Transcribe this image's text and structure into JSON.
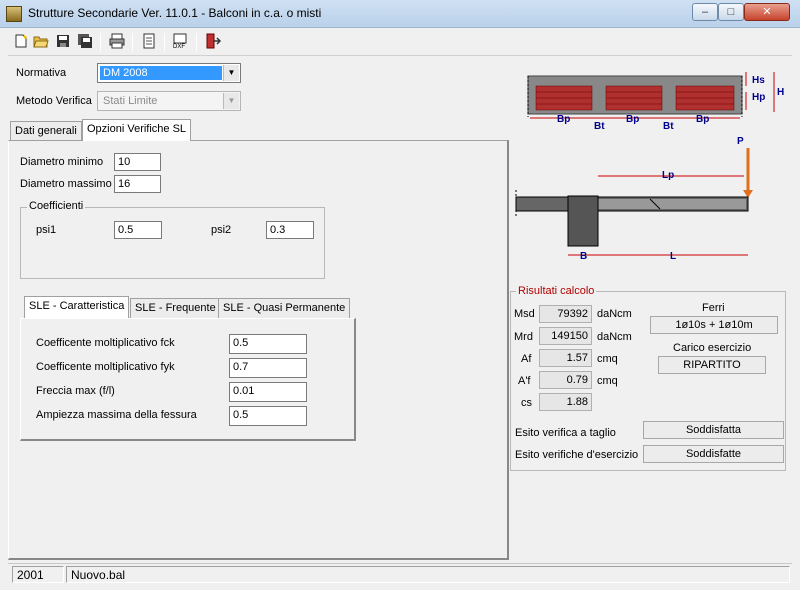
{
  "window": {
    "title": "Strutture Secondarie Ver. 11.0.1 - Balconi in c.a. o misti",
    "min": "–",
    "max": "□",
    "close": "✕"
  },
  "toolbar": {
    "icons": [
      "new-file-icon",
      "open-folder-icon",
      "save-icon",
      "save-all-icon",
      "print-icon",
      "preview-icon",
      "dxf-export-icon",
      "exit-icon"
    ]
  },
  "form": {
    "normativa_label": "Normativa",
    "normativa_value": "DM 2008",
    "metodo_label": "Metodo Verifica",
    "metodo_value": "Stati Limite"
  },
  "tabs": [
    "Dati generali",
    "Opzioni Verifiche SL"
  ],
  "opzioni": {
    "diam_min_label": "Diametro minimo",
    "diam_min": "10",
    "diam_max_label": "Diametro massimo",
    "diam_max": "16",
    "coeff_label": "Coefficienti",
    "psi1_label": "psi1",
    "psi1": "0.5",
    "psi2_label": "psi2",
    "psi2": "0.3"
  },
  "sle_tabs": [
    "SLE - Caratteristica",
    "SLE - Frequente",
    "SLE - Quasi Permanente"
  ],
  "sle": {
    "fck_label": "Coefficente moltiplicativo fck",
    "fck": "0.5",
    "fyk_label": "Coefficente moltiplicativo fyk",
    "fyk": "0.7",
    "freccia_label": "Freccia max (f/l)",
    "freccia": "0.01",
    "fessura_label": "Ampiezza massima della fessura",
    "fessura": "0.5"
  },
  "diagram": {
    "hs": "Hs",
    "hp": "Hp",
    "h": "H",
    "bp": "Bp",
    "bt": "Bt",
    "p": "P",
    "lp": "Lp",
    "b": "B",
    "l": "L"
  },
  "risultati": {
    "title": "Risultati calcolo",
    "msd_label": "Msd",
    "msd": "79392",
    "msd_unit": "daNcm",
    "mrd_label": "Mrd",
    "mrd": "149150",
    "mrd_unit": "daNcm",
    "af_label": "Af",
    "af": "1.57",
    "af_unit": "cmq",
    "a1f_label": "A'f",
    "a1f": "0.79",
    "a1f_unit": "cmq",
    "cs_label": "cs",
    "cs": "1.88",
    "ferri_label": "Ferri",
    "ferri": "1ø10s +   1ø10m",
    "carico_label": "Carico esercizio",
    "carico": "RIPARTITO",
    "taglio_label": "Esito verifica a taglio",
    "taglio": "Soddisfatta",
    "esercizio_label": "Esito verifiche d'esercizio",
    "esercizio": "Soddisfatte"
  },
  "status": {
    "year": "2001",
    "file": "Nuovo.bal"
  },
  "colors": {
    "accent": "#3399ff",
    "brick": "#b03030",
    "beam": "#808080",
    "dim": "#cc0000",
    "arrow": "#e07020",
    "groupTitle": "#b00000"
  }
}
